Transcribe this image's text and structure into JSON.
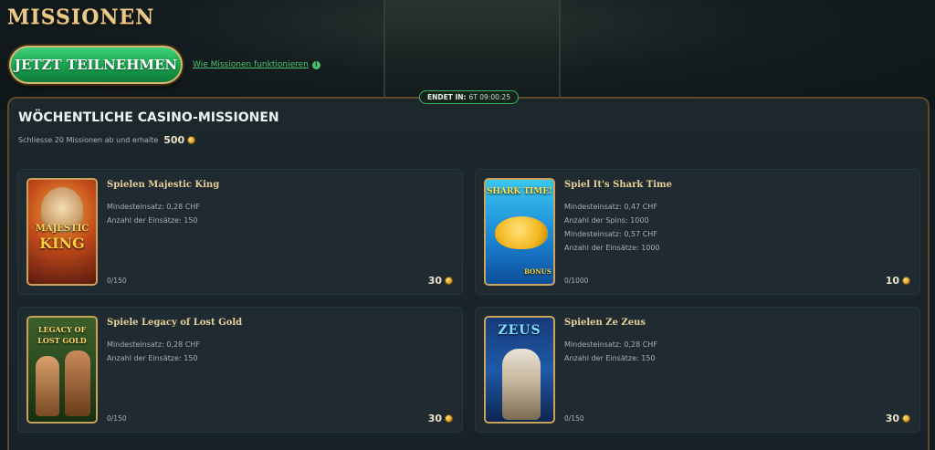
{
  "page": {
    "title": "MISSIONEN"
  },
  "actions": {
    "join_label": "JETZT TEILNEHMEN",
    "help_link": "Wie Missionen funktionieren",
    "help_icon": "info-icon"
  },
  "timer": {
    "label": "ENDET IN:",
    "value": "6T 09:00:25"
  },
  "section": {
    "title": "WÖCHENTLICHE CASINO-MISSIONEN",
    "subtitle": "Schliesse 20 Missionen ab und erhalte",
    "reward": "500"
  },
  "missions": [
    {
      "title": "Spielen Majestic King",
      "requirements": [
        "Mindesteinsatz: 0,28 CHF",
        "Anzahl der Einsätze: 150"
      ],
      "progress": "0/150",
      "reward": "30",
      "thumb_text": [
        "MAJESTIC",
        "KING"
      ]
    },
    {
      "title": "Spiel It's Shark Time",
      "requirements": [
        "Mindesteinsatz: 0,47 CHF",
        "Anzahl der Spins: 1000",
        "Mindesteinsatz: 0,57 CHF",
        "Anzahl der Einsätze: 1000"
      ],
      "progress": "0/1000",
      "reward": "10",
      "thumb_text": [
        "SHARK TIME!",
        "BONUS"
      ]
    },
    {
      "title": "Spiele Legacy of Lost Gold",
      "requirements": [
        "Mindesteinsatz: 0,28 CHF",
        "Anzahl der Einsätze: 150"
      ],
      "progress": "0/150",
      "reward": "30",
      "thumb_text": [
        "LEGACY OF",
        "LOST GOLD"
      ]
    },
    {
      "title": "Spielen Ze Zeus",
      "requirements": [
        "Mindesteinsatz: 0,28 CHF",
        "Anzahl der Einsätze: 150"
      ],
      "progress": "0/150",
      "reward": "30",
      "thumb_text": [
        "ZEUS"
      ]
    }
  ],
  "colors": {
    "accent_green": "#49c66d",
    "gold": "#e6cf9a",
    "panel_bg": "#1d282c"
  }
}
